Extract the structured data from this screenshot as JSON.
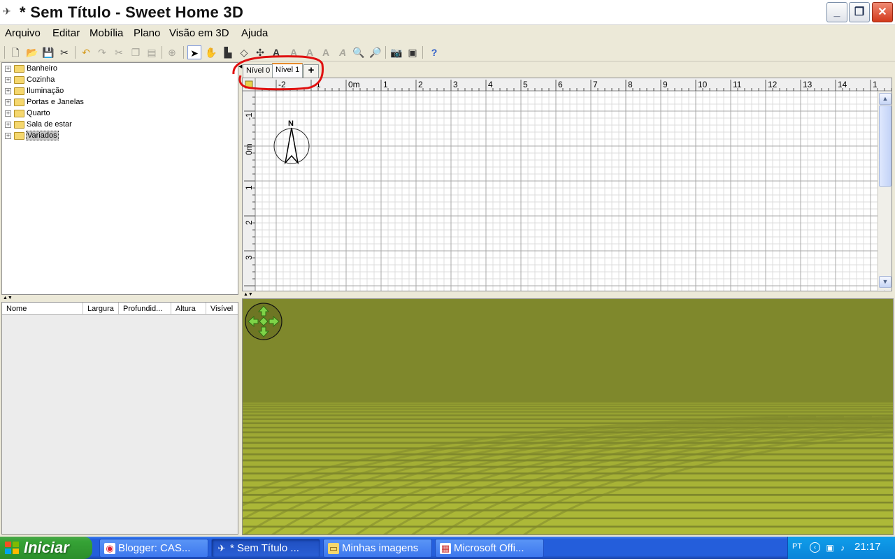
{
  "window": {
    "title": "* Sem Título - Sweet Home 3D",
    "minimize_glyph": "_",
    "maximize_glyph": "❐",
    "close_glyph": "✕"
  },
  "menu": [
    "Arquivo",
    "Editar",
    "Mobília",
    "Plano",
    "Visão em 3D",
    "Ajuda"
  ],
  "toolbar_icons": [
    "new-icon",
    "open-icon",
    "save-icon",
    "preferences-icon",
    "undo-icon",
    "redo-icon",
    "cut-icon",
    "copy-icon",
    "paste-icon",
    "add-furniture-icon",
    "select-icon",
    "pan-icon",
    "create-walls-icon",
    "create-rooms-icon",
    "create-dimensions-icon",
    "create-labels-icon",
    "text-style-icon",
    "text-bold-icon",
    "text-italic-icon",
    "zoom-in-icon",
    "zoom-out-icon",
    "create-photo-icon",
    "create-video-icon",
    "help-icon"
  ],
  "catalog": {
    "categories": [
      "Banheiro",
      "Cozinha",
      "Iluminação",
      "Portas e Janelas",
      "Quarto",
      "Sala de estar",
      "Variados"
    ],
    "selected": "Variados"
  },
  "furniture_table": {
    "columns": [
      "Nome",
      "Largura",
      "Profundid...",
      "Altura",
      "Visível"
    ]
  },
  "levels": {
    "tabs": [
      "Nível 0",
      "Nível 1"
    ],
    "active": "Nível 1",
    "add_label": "+"
  },
  "plan": {
    "ruler_x_labels": [
      "-2",
      "-1",
      "0m",
      "1",
      "2",
      "3",
      "4",
      "5",
      "6",
      "7",
      "8",
      "9",
      "10",
      "11",
      "12",
      "13",
      "14",
      "1"
    ],
    "ruler_y_labels": [
      "-1",
      "0m",
      "1",
      "2",
      "3"
    ],
    "compass_letter": "N"
  },
  "colors": {
    "ground_3d": "#7f882c",
    "ground_pattern": "#b5c13a",
    "annotation": "#e01010",
    "active_tab_accent": "#e68b2c"
  },
  "taskbar": {
    "start_label": "Iniciar",
    "tasks": [
      {
        "label": "Blogger: CAS...",
        "icon": "chrome-icon"
      },
      {
        "label": "* Sem Título ...",
        "icon": "sweethome-icon"
      },
      {
        "label": "Minhas imagens",
        "icon": "folder-icon"
      },
      {
        "label": "Microsoft Offi...",
        "icon": "office-icon"
      }
    ],
    "active_task": 1,
    "language": "PT",
    "clock": "21:17"
  }
}
